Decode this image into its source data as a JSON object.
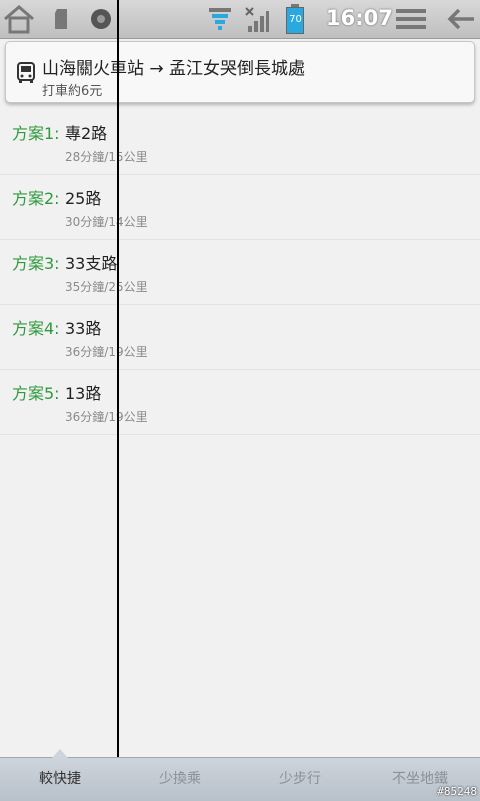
{
  "status_bar": {
    "time": "16:07",
    "battery": "70",
    "icons": [
      "home-icon",
      "sd-card-icon",
      "camera-icon",
      "wifi-icon",
      "signal-icon",
      "battery-icon",
      "menu-icon",
      "back-icon"
    ]
  },
  "route": {
    "title": "山海關火車站 → 孟江女哭倒長城處",
    "taxi_estimate": "打車約6元"
  },
  "plans": [
    {
      "label": "方案1:",
      "route": "專2路",
      "meta": "28分鐘/15公里"
    },
    {
      "label": "方案2:",
      "route": "25路",
      "meta": "30分鐘/14公里"
    },
    {
      "label": "方案3:",
      "route": "33支路",
      "meta": "35分鐘/25公里"
    },
    {
      "label": "方案4:",
      "route": "33路",
      "meta": "36分鐘/19公里"
    },
    {
      "label": "方案5:",
      "route": "13路",
      "meta": "36分鐘/19公里"
    }
  ],
  "tabs": [
    {
      "label": "較快捷",
      "active": true
    },
    {
      "label": "少換乘",
      "active": false
    },
    {
      "label": "少步行",
      "active": false
    },
    {
      "label": "不坐地鐵",
      "active": false
    }
  ],
  "watermark": "#85248",
  "colors": {
    "plan_label": "#2f9a3c",
    "accent_battery": "#2aa9e0"
  }
}
